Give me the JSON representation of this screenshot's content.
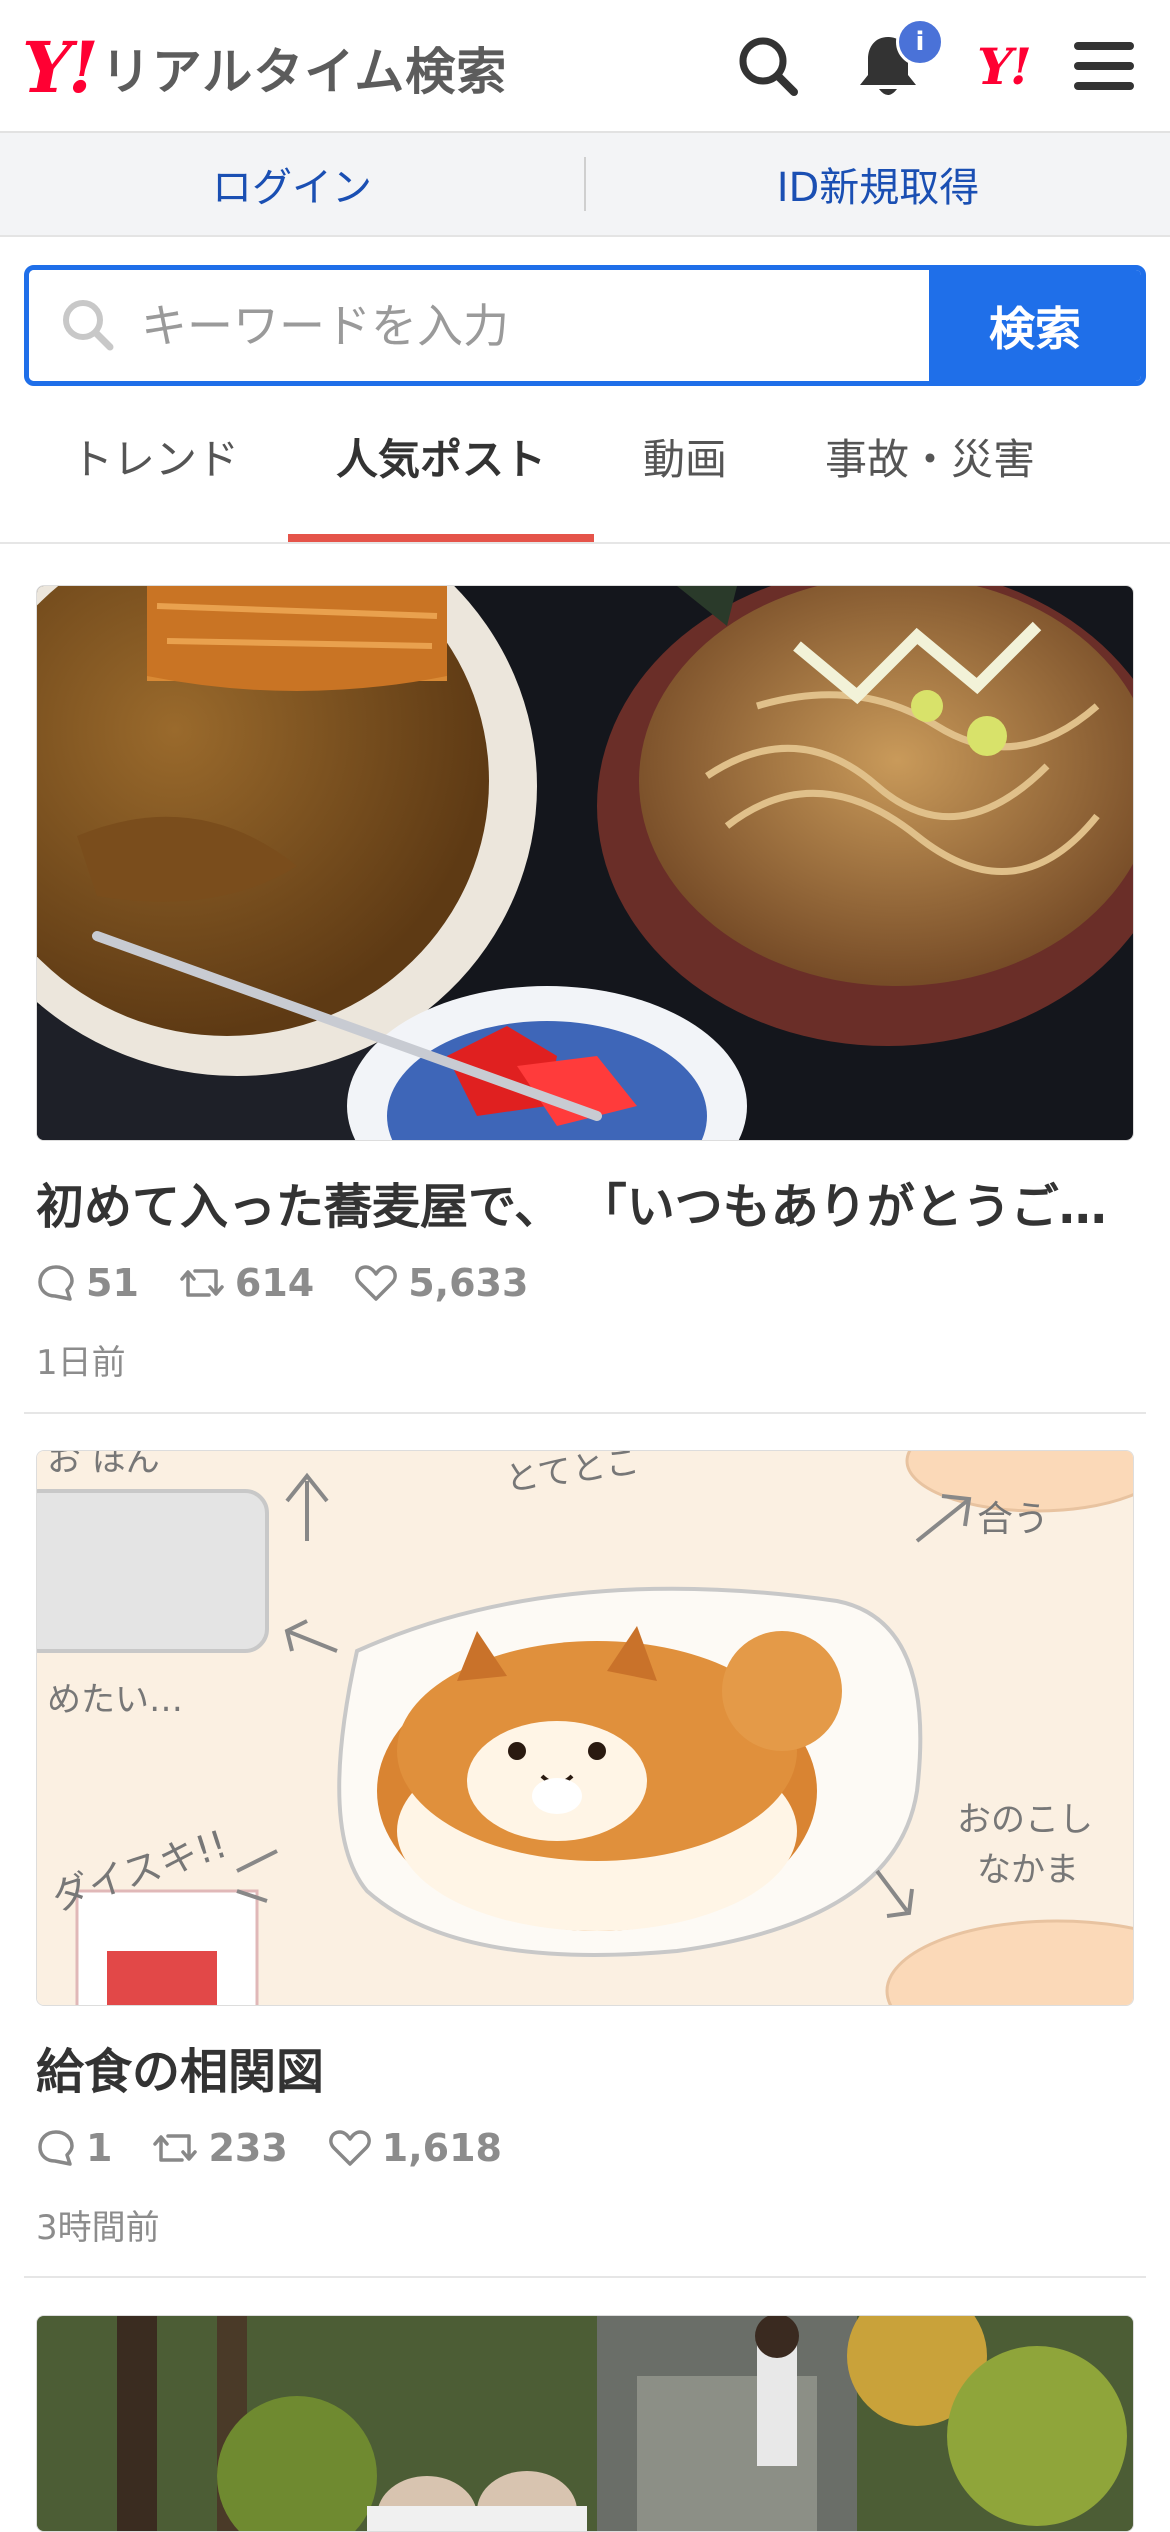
{
  "header": {
    "logo_mark": "Y!",
    "logo_text": "リアルタイム検索",
    "notification_badge": "i",
    "yj_mark": "Y!"
  },
  "account": {
    "login_label": "ログイン",
    "signup_label": "ID新規取得"
  },
  "search": {
    "placeholder": "キーワードを入力",
    "button_label": "検索"
  },
  "tabs": [
    {
      "label": "トレンド",
      "active": false
    },
    {
      "label": "人気ポスト",
      "active": true
    },
    {
      "label": "動画",
      "active": false
    },
    {
      "label": "事故・災害",
      "active": false
    }
  ],
  "posts": [
    {
      "title": "初めて入った蕎麦屋で、 「いつもありがとうご…",
      "replies": "51",
      "reposts": "614",
      "likes": "5,633",
      "time": "1日前"
    },
    {
      "title": "給食の相関図",
      "replies": "1",
      "reposts": "233",
      "likes": "1,618",
      "time": "3時間前"
    }
  ],
  "image_texts": {
    "a": "お ほん",
    "b": "とてとこ",
    "c": "合う",
    "d": "めたい…",
    "e": "ダイスキ!!",
    "f": "おのこし",
    "g": "なかま"
  },
  "colors": {
    "brand_red": "#ff0033",
    "search_blue": "#1f6fe9",
    "link_blue": "#1a4fb3",
    "tab_underline": "#e5544a",
    "badge_blue": "#4a72d8"
  }
}
